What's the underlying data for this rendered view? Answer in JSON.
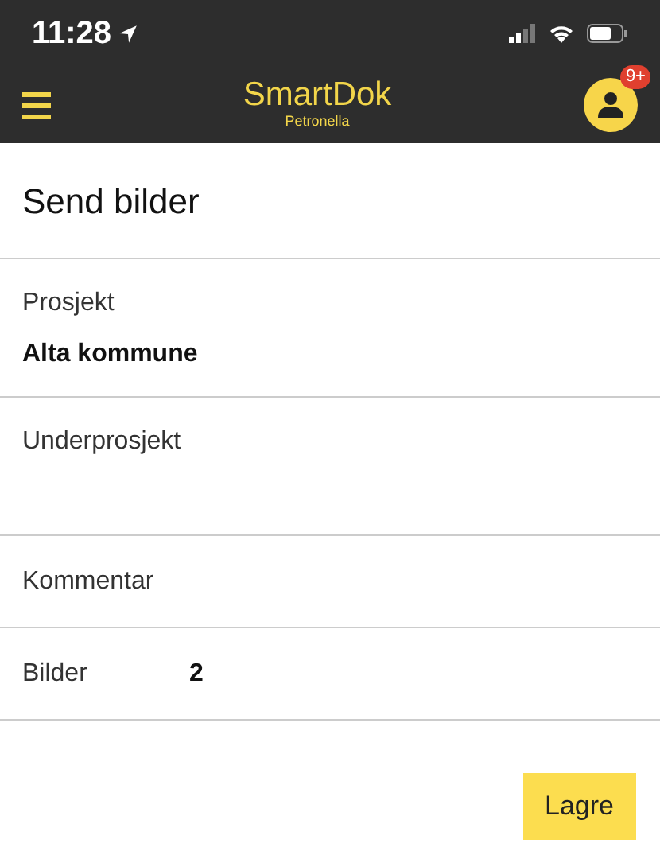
{
  "status_bar": {
    "time": "11:28"
  },
  "app_bar": {
    "title": "SmartDok",
    "subtitle": "Petronella",
    "badge": "9+"
  },
  "page_title": "Send bilder",
  "fields": [
    {
      "kind": "select",
      "label": "Prosjekt",
      "value": "Alta kommune"
    },
    {
      "kind": "select",
      "label": "Underprosjekt"
    },
    {
      "kind": "text",
      "label": "Kommentar"
    },
    {
      "kind": "count",
      "label": "Bilder",
      "value": "2"
    }
  ],
  "buttons": [
    {
      "label": "Lagre"
    }
  ]
}
